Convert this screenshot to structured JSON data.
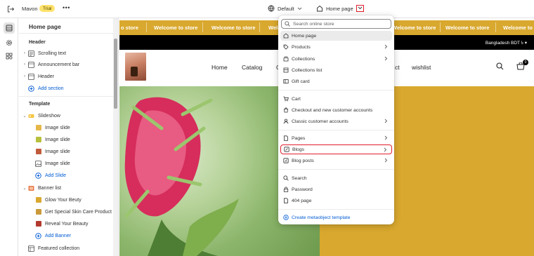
{
  "topbar": {
    "store_name": "Mavon",
    "trial_badge": "Trial",
    "more_label": "•••",
    "theme_name": "Default",
    "page_selector": "Home page"
  },
  "sidebar": {
    "title": "Home page",
    "header_section_title": "Header",
    "header_items": [
      {
        "label": "Scrolling text",
        "icon": "text-block-icon"
      },
      {
        "label": "Announcement bar",
        "icon": "layout-icon"
      },
      {
        "label": "Header",
        "icon": "layout-icon"
      }
    ],
    "add_section_label": "Add section",
    "template_section_title": "Template",
    "slideshow_label": "Slideshow",
    "slides": [
      "Image slide",
      "Image slide",
      "Image slide",
      "Image slide"
    ],
    "add_slide_label": "Add Slide",
    "banner_list_label": "Banner list",
    "banners": [
      "Glow Your Beuty",
      "Get Special Skin Care Product",
      "Reveal Your Beauty"
    ],
    "add_banner_label": "Add Banner",
    "featured_collection_label": "Featured collection"
  },
  "preview": {
    "marquee_items": [
      "o store",
      "Welcome to store",
      "Welcome to store",
      "Welcome to store",
      "Welcome to store",
      "Welcome to store",
      "Welcome to store",
      "Welcome to store",
      "Welcome to"
    ],
    "currency": "Bangladesh BDT ৳ ▾",
    "nav_items": [
      "Home",
      "Catalog",
      "C",
      "ct",
      "wishlist"
    ],
    "cart_count": "0"
  },
  "dropdown": {
    "search_placeholder": "Search online store",
    "group1": [
      {
        "label": "Home page",
        "icon": "home-icon",
        "arrow": false,
        "selected": true
      },
      {
        "label": "Products",
        "icon": "tag-icon",
        "arrow": true
      },
      {
        "label": "Collections",
        "icon": "collections-icon",
        "arrow": true
      },
      {
        "label": "Collections list",
        "icon": "list-icon",
        "arrow": false
      },
      {
        "label": "Gift card",
        "icon": "gift-card-icon",
        "arrow": false
      }
    ],
    "group2": [
      {
        "label": "Cart",
        "icon": "cart-icon",
        "arrow": false
      },
      {
        "label": "Checkout and new customer accounts",
        "icon": "checkout-icon",
        "arrow": false
      },
      {
        "label": "Classic customer accounts",
        "icon": "person-icon",
        "arrow": true
      }
    ],
    "group3": [
      {
        "label": "Pages",
        "icon": "page-icon",
        "arrow": true
      },
      {
        "label": "Blogs",
        "icon": "blog-icon",
        "arrow": true,
        "highlighted": true
      },
      {
        "label": "Blog posts",
        "icon": "blog-post-icon",
        "arrow": true
      }
    ],
    "group4": [
      {
        "label": "Search",
        "icon": "search-icon",
        "arrow": false
      },
      {
        "label": "Password",
        "icon": "password-icon",
        "arrow": false
      },
      {
        "label": "404 page",
        "icon": "error-page-icon",
        "arrow": false
      }
    ],
    "create_label": "Create metaobject template"
  },
  "colors": {
    "accent_blue": "#005bd3",
    "marquee": "#d9a82e",
    "highlight_red": "#e11d2b",
    "trial": "#ffe26b"
  }
}
